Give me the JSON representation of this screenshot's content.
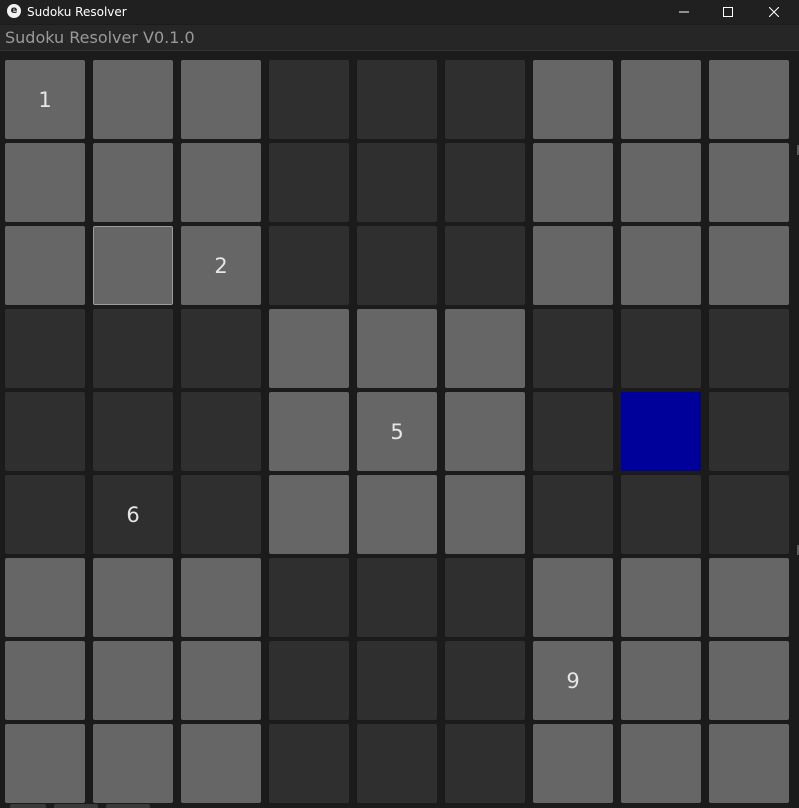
{
  "window": {
    "title": "Sudoku Resolver",
    "icon_letter": "e",
    "controls": [
      "minimize-icon",
      "maximize-icon",
      "close-icon"
    ]
  },
  "header": {
    "title": "Sudoku Resolver V0.1.0"
  },
  "board": {
    "rows": [
      [
        "1",
        "",
        "",
        "",
        "",
        "",
        "",
        "",
        ""
      ],
      [
        "",
        "",
        "",
        "",
        "",
        "",
        "",
        "",
        ""
      ],
      [
        "",
        "",
        "2",
        "",
        "",
        "",
        "",
        "",
        ""
      ],
      [
        "",
        "",
        "",
        "",
        "",
        "",
        "",
        "",
        ""
      ],
      [
        "",
        "",
        "",
        "",
        "5",
        "",
        "",
        "",
        ""
      ],
      [
        "",
        "6",
        "",
        "",
        "",
        "",
        "",
        "",
        ""
      ],
      [
        "",
        "",
        "",
        "",
        "",
        "",
        "",
        "",
        ""
      ],
      [
        "",
        "",
        "",
        "",
        "",
        "",
        "9",
        "",
        ""
      ],
      [
        "",
        "",
        "",
        "",
        "",
        "",
        "",
        "",
        ""
      ]
    ],
    "selected_cell": {
      "row": 4,
      "col": 7
    },
    "hovered_cell": {
      "row": 2,
      "col": 1
    },
    "colors": {
      "light_box": "#666666",
      "dark_box": "#2f2f2f",
      "selected": "#00009a",
      "digit": "#e6e6e6",
      "background": "#1b1b1b"
    }
  }
}
